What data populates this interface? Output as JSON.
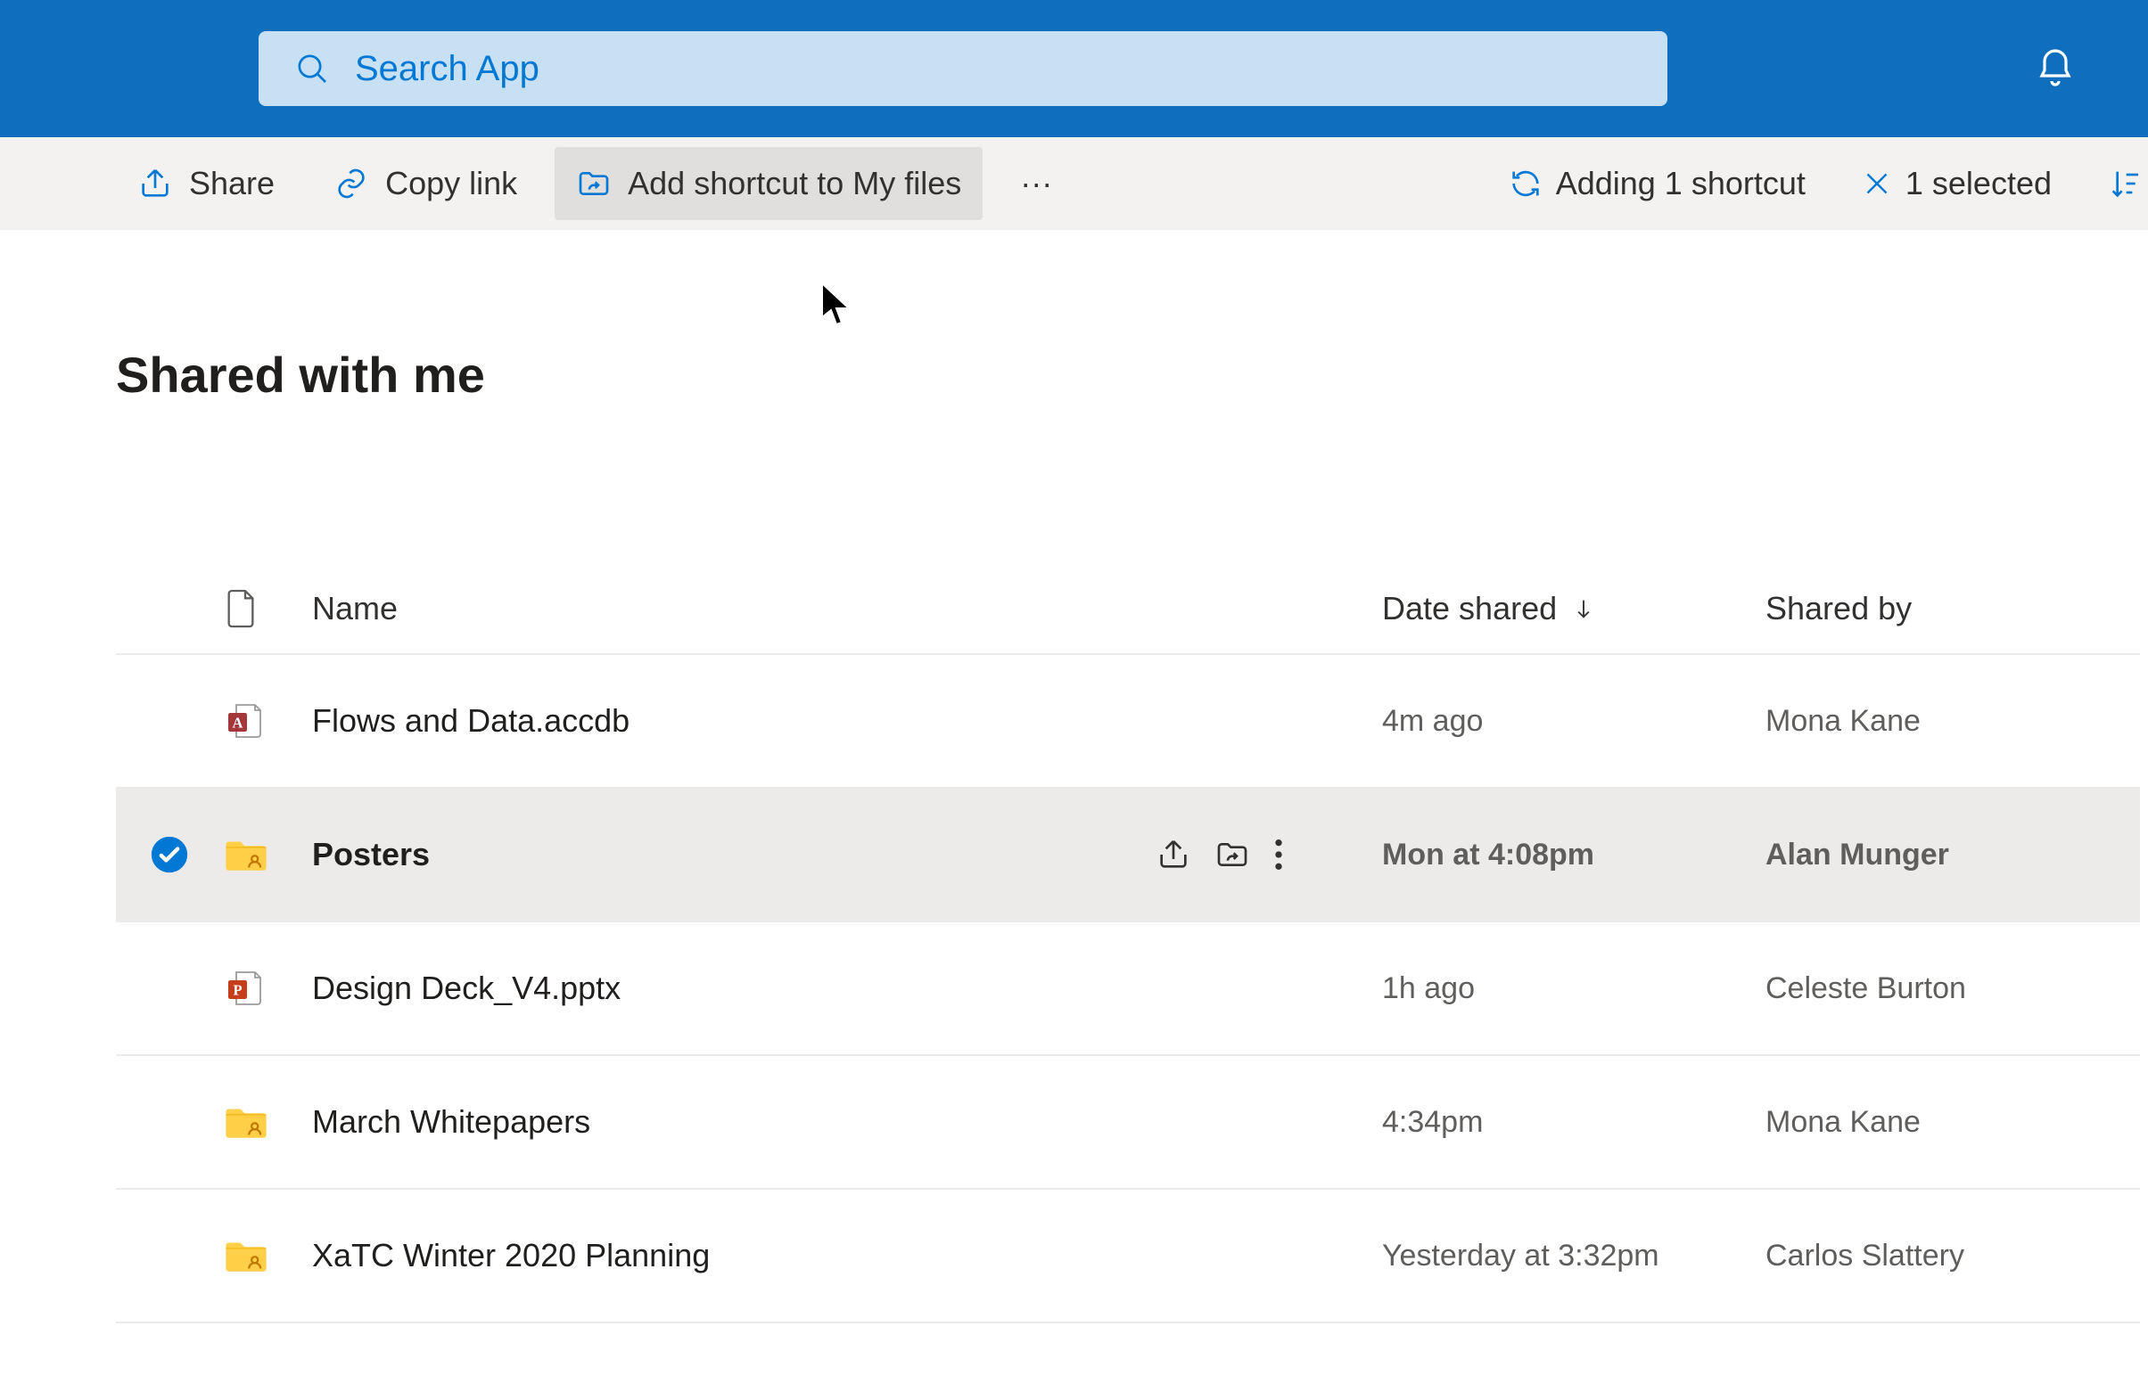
{
  "header": {
    "search_placeholder": "Search App"
  },
  "commandBar": {
    "share": "Share",
    "copyLink": "Copy link",
    "addShortcut": "Add shortcut to My files",
    "overflow": "···",
    "adding": "Adding 1 shortcut",
    "selected": "1 selected"
  },
  "page": {
    "title": "Shared with me"
  },
  "columns": {
    "name": "Name",
    "dateShared": "Date shared",
    "sharedBy": "Shared by"
  },
  "rows": [
    {
      "icon": "access",
      "name": "Flows and Data.accdb",
      "dateShared": "4m ago",
      "sharedBy": "Mona Kane",
      "selected": false
    },
    {
      "icon": "folder-shared",
      "name": "Posters",
      "dateShared": "Mon at 4:08pm",
      "sharedBy": "Alan Munger",
      "selected": true
    },
    {
      "icon": "powerpoint",
      "name": "Design Deck_V4.pptx",
      "dateShared": "1h ago",
      "sharedBy": "Celeste Burton",
      "selected": false
    },
    {
      "icon": "folder-shared",
      "name": "March Whitepapers",
      "dateShared": "4:34pm",
      "sharedBy": "Mona Kane",
      "selected": false
    },
    {
      "icon": "folder-shared",
      "name": "XaTC Winter 2020 Planning",
      "dateShared": "Yesterday at 3:32pm",
      "sharedBy": "Carlos Slattery",
      "selected": false
    }
  ]
}
